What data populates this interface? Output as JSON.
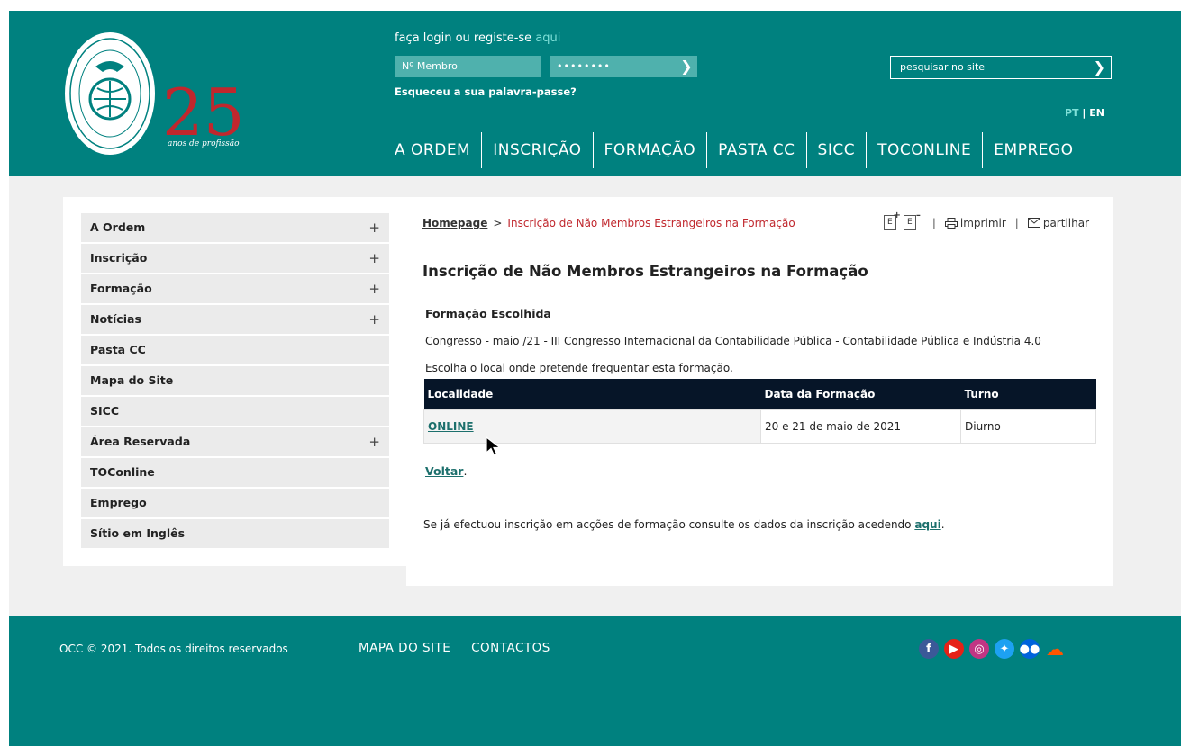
{
  "header": {
    "logo_number": "25",
    "logo_caption": "anos de profissão",
    "login_prompt": "faça login ou registe-se",
    "login_link": "aqui",
    "member_placeholder": "Nº Membro",
    "password_mask": "••••••••",
    "forgot_password": "Esqueceu a sua palavra-passe?",
    "search_placeholder": "pesquisar no site",
    "lang_pt": "PT",
    "lang_sep": "|",
    "lang_en": "EN",
    "nav": [
      "A ORDEM",
      "INSCRIÇÃO",
      "FORMAÇÃO",
      "PASTA CC",
      "SICC",
      "TOCONLINE",
      "EMPREGO"
    ]
  },
  "sidebar": {
    "items": [
      {
        "label": "A Ordem",
        "expand": "+"
      },
      {
        "label": "Inscrição",
        "expand": "+"
      },
      {
        "label": "Formação",
        "expand": "+"
      },
      {
        "label": "Notícias",
        "expand": "+"
      },
      {
        "label": "Pasta CC",
        "expand": ""
      },
      {
        "label": "Mapa do Site",
        "expand": ""
      },
      {
        "label": "SICC",
        "expand": ""
      },
      {
        "label": "Área Reservada",
        "expand": "+"
      },
      {
        "label": "TOConline",
        "expand": ""
      },
      {
        "label": "Emprego",
        "expand": ""
      },
      {
        "label": "Sítio em Inglês",
        "expand": ""
      }
    ]
  },
  "content": {
    "breadcrumb_home": "Homepage",
    "breadcrumb_sep": ">",
    "breadcrumb_current": "Inscrição de Não Membros Estrangeiros na Formação",
    "font_increase": "E",
    "font_decrease": "E",
    "tool_sep": "|",
    "print_label": "imprimir",
    "share_label": "partilhar",
    "title": "Inscrição de Não Membros Estrangeiros na Formação",
    "chosen_label": "Formação Escolhida",
    "course": "Congresso - maio /21 - III Congresso Internacional da Contabilidade Pública - Contabilidade Pública e Indústria 4.0",
    "choose_text": "Escolha o local onde pretende frequentar esta formação.",
    "table": {
      "headers": [
        "Localidade",
        "Data da Formação",
        "Turno"
      ],
      "rows": [
        {
          "localidade": "ONLINE",
          "data": "20 e 21 de maio de 2021",
          "turno": "Diurno"
        }
      ]
    },
    "back_link": "Voltar",
    "back_suffix": ".",
    "note_text": "Se já efectuou inscrição em acções de formação consulte os dados da inscrição acedendo",
    "note_link": "aqui",
    "note_suffix": "."
  },
  "footer": {
    "copyright": "OCC © 2021. Todos os direitos reservados",
    "links": [
      "MAPA DO SITE",
      "CONTACTOS"
    ],
    "social": [
      {
        "name": "facebook-icon",
        "glyph": "f",
        "color": "#3b5998"
      },
      {
        "name": "youtube-icon",
        "glyph": "▶",
        "color": "#e62117"
      },
      {
        "name": "instagram-icon",
        "glyph": "◎",
        "color": "#c13584"
      },
      {
        "name": "twitter-icon",
        "glyph": "✦",
        "color": "#1da1f2"
      },
      {
        "name": "flickr-icon",
        "glyph": "●●",
        "color": "#0063dc"
      },
      {
        "name": "soundcloud-icon",
        "glyph": "☁",
        "color": "#ff5500"
      }
    ]
  },
  "colors": {
    "brand": "#00817f",
    "accent_red": "#c0272d",
    "table_header": "#061528"
  }
}
